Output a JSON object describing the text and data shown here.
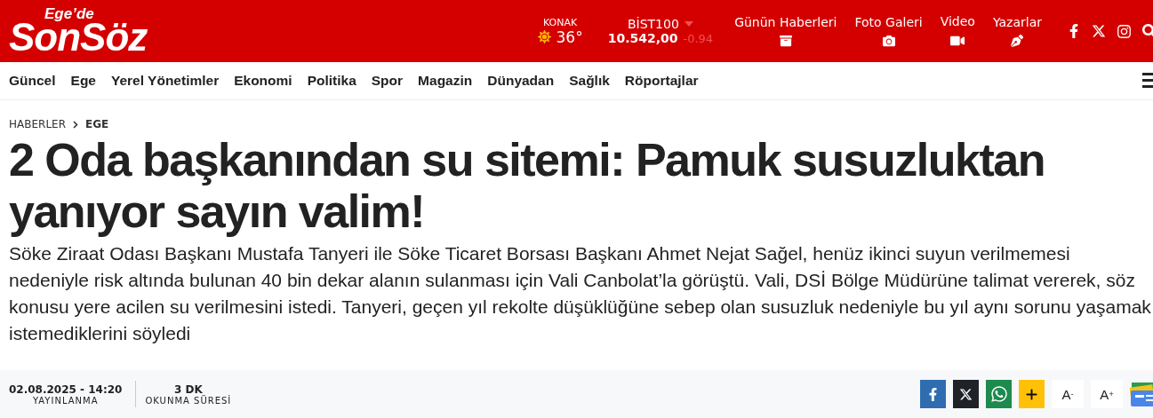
{
  "logo": {
    "top": "Ege’de",
    "main": "SonSöz"
  },
  "weather": {
    "city": "KONAK",
    "temperature": "36°"
  },
  "market": {
    "name": "BİST100",
    "value": "10.542,00",
    "change": "-0.94"
  },
  "header_links": [
    {
      "label": "Günün Haberleri",
      "kind": "archive"
    },
    {
      "label": "Foto Galeri",
      "kind": "camera"
    },
    {
      "label": "Video",
      "kind": "video"
    },
    {
      "label": "Yazarlar",
      "kind": "pen"
    }
  ],
  "social": [
    {
      "kind": "facebook"
    },
    {
      "kind": "x"
    },
    {
      "kind": "instagram"
    }
  ],
  "nav": [
    "Güncel",
    "Ege",
    "Yerel Yönetimler",
    "Ekonomi",
    "Politika",
    "Spor",
    "Magazin",
    "Dünyadan",
    "Sağlık",
    "Röportajlar"
  ],
  "breadcrumb": [
    "HABERLER",
    "EGE"
  ],
  "headline": "2 Oda başkanından su sitemi: Pamuk susuzluktan yanıyor sayın valim!",
  "summary": "Söke Ziraat Odası Başkanı Mustafa Tanyeri ile Söke Ticaret Borsası Başkanı Ahmet Nejat Sağel, henüz ikinci suyun verilmemesi nedeniyle risk altında bulunan 40 bin dekar alanın sulanması için Vali Canbolat’la görüştü. Vali, DSİ Bölge Müdürüne talimat vererek, söz konusu yere acilen su verilmesini istedi. Tanyeri, geçen yıl rekolte düşüklüğüne sebep olan susuzluk nedeniyle bu yıl aynı sorunu yaşamak istemediklerini söyledi",
  "meta": [
    {
      "value": "02.08.2025 - 14:20",
      "label": "YAYINLANMA"
    },
    {
      "value": "3 DK",
      "label": "OKUNMA SÜRESİ"
    }
  ],
  "share": [
    {
      "kind": "facebook"
    },
    {
      "kind": "x"
    },
    {
      "kind": "whatsapp"
    },
    {
      "kind": "plus"
    },
    {
      "kind": "font",
      "label": "A",
      "sign": "-"
    },
    {
      "kind": "font",
      "label": "A",
      "sign": "+"
    },
    {
      "kind": "gnews"
    }
  ]
}
